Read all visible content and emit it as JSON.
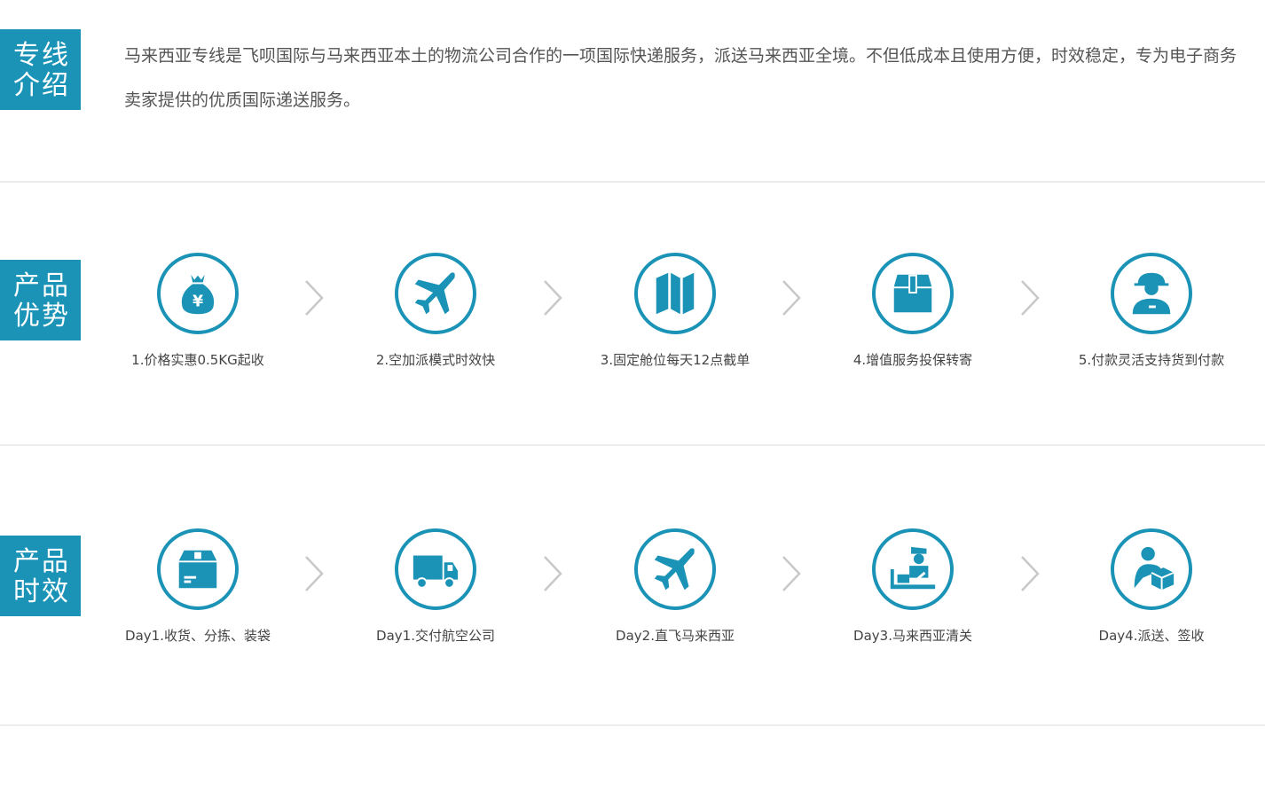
{
  "intro": {
    "tag_line1": "专线",
    "tag_line2": "介绍",
    "text": "马来西亚专线是飞呗国际与马来西亚本土的物流公司合作的一项国际快递服务，派送马来西亚全境。不但低成本且使用方便，时效稳定，专为电子商务卖家提供的优质国际递送服务。"
  },
  "advantages": {
    "tag_line1": "产品",
    "tag_line2": "优势",
    "items": [
      {
        "label": "1.价格实惠0.5KG起收",
        "icon": "money-bag-icon"
      },
      {
        "label": "2.空加派模式时效快",
        "icon": "airplane-icon"
      },
      {
        "label": "3.固定舱位每天12点截单",
        "icon": "map-icon"
      },
      {
        "label": "4.增值服务投保转寄",
        "icon": "package-icon"
      },
      {
        "label": "5.付款灵活支持货到付款",
        "icon": "courier-icon"
      }
    ]
  },
  "timeline": {
    "tag_line1": "产品",
    "tag_line2": "时效",
    "items": [
      {
        "label": "Day1.收货、分拣、装袋",
        "icon": "box-icon"
      },
      {
        "label": "Day1.交付航空公司",
        "icon": "truck-icon"
      },
      {
        "label": "Day2.直飞马来西亚",
        "icon": "airplane-icon"
      },
      {
        "label": "Day3.马来西亚清关",
        "icon": "customs-officer-icon"
      },
      {
        "label": "Day4.派送、签收",
        "icon": "delivery-person-icon"
      }
    ]
  },
  "colors": {
    "accent": "#1a93b7",
    "divider": "#ececec",
    "arrow": "#c8c8c8"
  }
}
